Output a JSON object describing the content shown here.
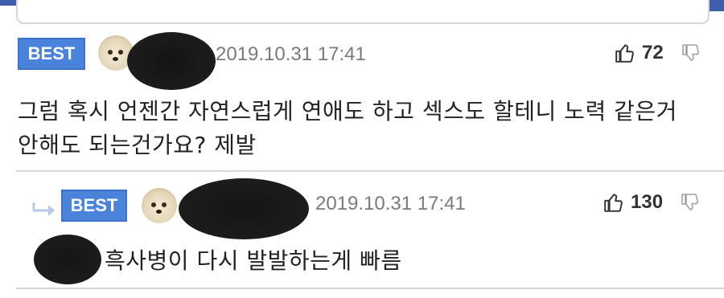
{
  "colors": {
    "accent_bar": "#3f5fae",
    "best_badge": "#4a83dc"
  },
  "comments": [
    {
      "badge": "BEST",
      "timestamp": "2019.10.31 17:41",
      "likes": "72",
      "text_line1": "그럼 혹시 언젠간 자연스럽게 연애도 하고 섹스도 할테니 노력 같은거",
      "text_line2": "안해도 되는건가요? 제발",
      "icons": [
        "avatar-dog-icon",
        "thumbs-up-icon",
        "thumbs-down-icon"
      ]
    },
    {
      "badge": "BEST",
      "timestamp": "2019.10.31 17:41",
      "likes": "130",
      "text": "흑사병이 다시 발발하는게 빠름",
      "icons": [
        "reply-arrow-icon",
        "avatar-dog-icon",
        "thumbs-up-icon",
        "thumbs-down-icon"
      ]
    }
  ]
}
